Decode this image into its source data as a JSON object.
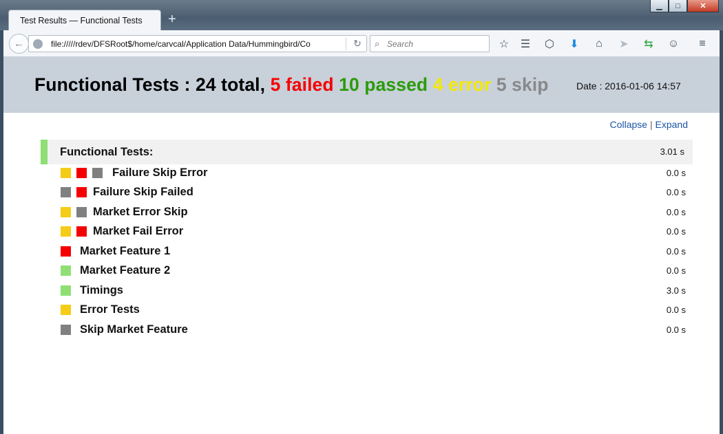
{
  "browser": {
    "tab_title": "Test Results — Functional Tests",
    "new_tab": "+",
    "url": "file://///rdev/DFSRoot$/home/carvcal/Application Data/Hummingbird/Co",
    "search_placeholder": "Search"
  },
  "header": {
    "prefix": "Functional Tests : ",
    "total": "24 total,",
    "failed": "5 failed",
    "passed": "10 passed",
    "error": "4 error",
    "skip": "5 skip",
    "date": "Date : 2016-01-06 14:57"
  },
  "colors": {
    "failed": "#f50000",
    "passed": "#2b9b0a",
    "error": "#f5e900",
    "skip": "#888888",
    "suite_bar": "#8fdf74",
    "sq_yellow": "#f5cc17",
    "sq_red": "#f50000",
    "sq_gray": "#808080",
    "sq_green": "#8fdf74"
  },
  "links": {
    "collapse": "Collapse",
    "separator": "|",
    "expand": "Expand"
  },
  "suite": {
    "name": "Functional Tests:",
    "time": "3.01 s"
  },
  "tests": [
    {
      "name": "Failure Skip Error",
      "time": "0.0 s",
      "squares": [
        "yellow",
        "red",
        "gray"
      ]
    },
    {
      "name": "Failure Skip Failed",
      "time": "0.0 s",
      "squares": [
        "gray",
        "red"
      ]
    },
    {
      "name": "Market Error Skip",
      "time": "0.0 s",
      "squares": [
        "yellow",
        "gray"
      ]
    },
    {
      "name": "Market Fail Error",
      "time": "0.0 s",
      "squares": [
        "yellow",
        "red"
      ]
    },
    {
      "name": "Market Feature 1",
      "time": "0.0 s",
      "squares": [
        "red"
      ]
    },
    {
      "name": "Market Feature 2",
      "time": "0.0 s",
      "squares": [
        "green"
      ]
    },
    {
      "name": "Timings",
      "time": "3.0 s",
      "squares": [
        "green"
      ]
    },
    {
      "name": "Error Tests",
      "time": "0.0 s",
      "squares": [
        "yellow"
      ]
    },
    {
      "name": "Skip Market Feature",
      "time": "0.0 s",
      "squares": [
        "gray"
      ]
    }
  ]
}
